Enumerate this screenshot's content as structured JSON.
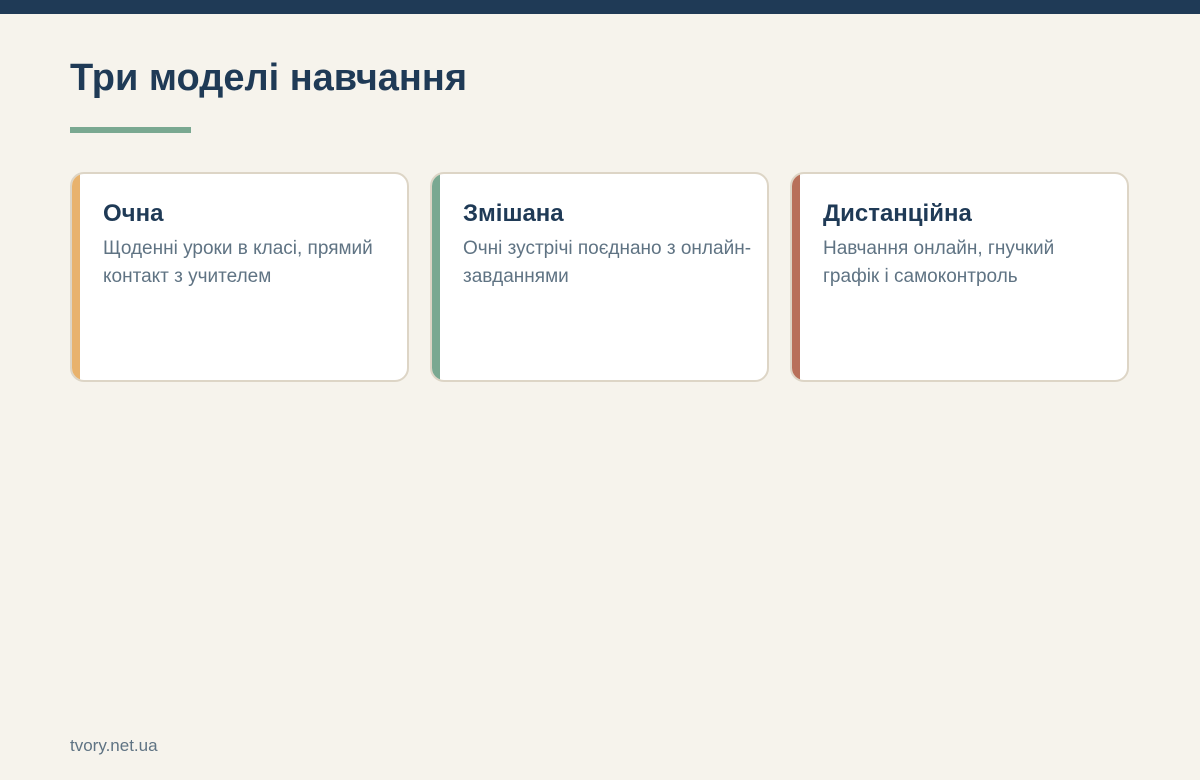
{
  "title": "Три моделі навчання",
  "colors": {
    "top_bar": "#1f3a56",
    "background": "#f6f3ec",
    "title_underline": "#7aa891"
  },
  "cards": [
    {
      "title": "Очна",
      "text": "Щоденні уроки в класі, прямий контакт з учителем",
      "accent_color": "#e8b26d"
    },
    {
      "title": "Змішана",
      "text": "Очні зустрічі поєднано з онлайн-завданнями",
      "accent_color": "#7aa891"
    },
    {
      "title": "Дистанційна",
      "text": "Навчання онлайн, гнучкий графік і самоконтроль",
      "accent_color": "#b8705a"
    }
  ],
  "footer": "tvory.net.ua"
}
